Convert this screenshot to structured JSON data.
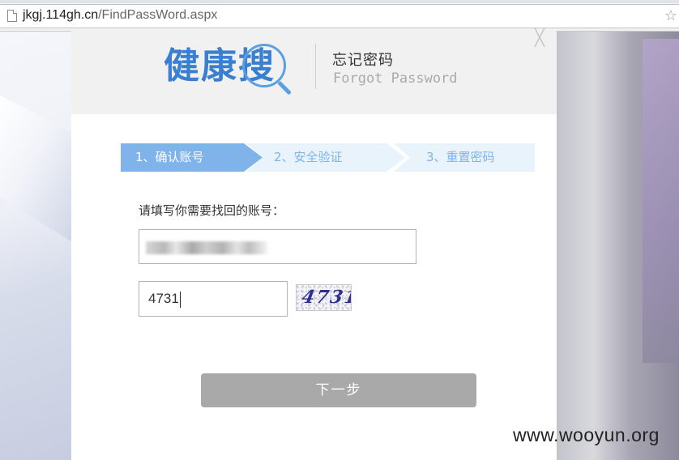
{
  "browser": {
    "url_domain": "jkgj.114gh.cn",
    "url_path": "/FindPassWord.aspx",
    "page_icon": "page-icon",
    "star_icon": "star-icon"
  },
  "dialog": {
    "close_glyph": "╳",
    "logo_text": "健康搜",
    "title_cn": "忘记密码",
    "title_en": "Forgot Password"
  },
  "steps": [
    {
      "label": "1、确认账号",
      "active": true
    },
    {
      "label": "2、安全验证",
      "active": false
    },
    {
      "label": "3、重置密码",
      "active": false
    }
  ],
  "form": {
    "prompt": "请填写你需要找回的账号：",
    "account_value": "",
    "captcha_value": "4731",
    "captcha_image_text": "4731",
    "next_label": "下一步"
  },
  "watermark": "www.wooyun.org",
  "colors": {
    "logo": "#3b7fd0",
    "step_active": "#7fb3ea",
    "step_inactive": "#e9f3fc",
    "button": "#a9a9a9"
  }
}
